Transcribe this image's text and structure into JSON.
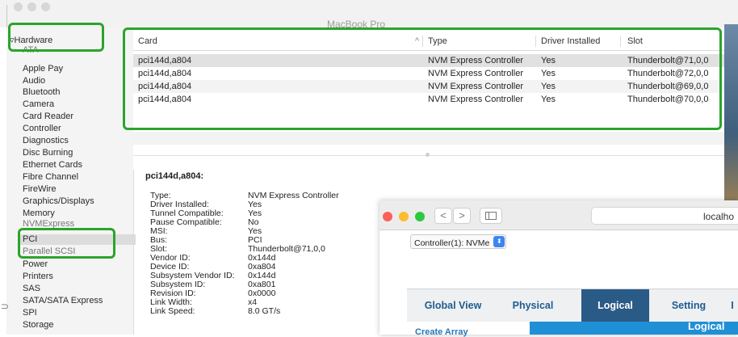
{
  "window": {
    "title": "MacBook Pro"
  },
  "sidebar": {
    "hardware_label": "Hardware",
    "items": [
      {
        "label": "ATA"
      },
      {
        "label": "Apple Pay"
      },
      {
        "label": "Audio"
      },
      {
        "label": "Bluetooth"
      },
      {
        "label": "Camera"
      },
      {
        "label": "Card Reader"
      },
      {
        "label": "Controller"
      },
      {
        "label": "Diagnostics"
      },
      {
        "label": "Disc Burning"
      },
      {
        "label": "Ethernet Cards"
      },
      {
        "label": "Fibre Channel"
      },
      {
        "label": "FireWire"
      },
      {
        "label": "Graphics/Displays"
      },
      {
        "label": "Memory"
      },
      {
        "label": "NVMExpress"
      },
      {
        "label": "PCI"
      },
      {
        "label": "Parallel SCSI"
      },
      {
        "label": "Power"
      },
      {
        "label": "Printers"
      },
      {
        "label": "SAS"
      },
      {
        "label": "SATA/SATA Express"
      },
      {
        "label": "SPI"
      },
      {
        "label": "Storage"
      }
    ],
    "selected": "PCI"
  },
  "table": {
    "columns": [
      "Card",
      "Type",
      "Driver Installed",
      "Slot"
    ],
    "sort_indicator": "^",
    "rows": [
      {
        "card": "pci144d,a804",
        "type": "NVM Express Controller",
        "driver": "Yes",
        "slot": "Thunderbolt@71,0,0"
      },
      {
        "card": "pci144d,a804",
        "type": "NVM Express Controller",
        "driver": "Yes",
        "slot": "Thunderbolt@72,0,0"
      },
      {
        "card": "pci144d,a804",
        "type": "NVM Express Controller",
        "driver": "Yes",
        "slot": "Thunderbolt@69,0,0"
      },
      {
        "card": "pci144d,a804",
        "type": "NVM Express Controller",
        "driver": "Yes",
        "slot": "Thunderbolt@70,0,0"
      }
    ]
  },
  "details": {
    "title": "pci144d,a804:",
    "fields": [
      {
        "key": "Type:",
        "value": "NVM Express Controller"
      },
      {
        "key": "Driver Installed:",
        "value": "Yes"
      },
      {
        "key": "Tunnel Compatible:",
        "value": "Yes"
      },
      {
        "key": "Pause Compatible:",
        "value": "No"
      },
      {
        "key": "MSI:",
        "value": "Yes"
      },
      {
        "key": "Bus:",
        "value": "PCI"
      },
      {
        "key": "Slot:",
        "value": "Thunderbolt@71,0,0"
      },
      {
        "key": "Vendor ID:",
        "value": "0x144d"
      },
      {
        "key": "Device ID:",
        "value": "0xa804"
      },
      {
        "key": "Subsystem Vendor ID:",
        "value": "0x144d"
      },
      {
        "key": "Subsystem ID:",
        "value": "0xa801"
      },
      {
        "key": "Revision ID:",
        "value": "0x0000"
      },
      {
        "key": "Link Width:",
        "value": "x4"
      },
      {
        "key": "Link Speed:",
        "value": "8.0 GT/s"
      }
    ]
  },
  "browser": {
    "address": "localho",
    "nav_back": "<",
    "nav_forward": ">",
    "controller_select": "Controller(1): NVMe",
    "tabs": [
      {
        "label": "Global View",
        "active": false
      },
      {
        "label": "Physical",
        "active": false
      },
      {
        "label": "Logical",
        "active": true
      },
      {
        "label": "Setting",
        "active": false
      },
      {
        "label": "I",
        "active": false
      }
    ],
    "create_array": "Create Array",
    "banner": "Logical"
  },
  "colors": {
    "highlight": "#2ba42b",
    "tab_active": "#2a5a86",
    "banner": "#1f8fd6",
    "traffic_red": "#fc5f57",
    "traffic_yellow": "#fdbc2e",
    "traffic_green": "#2ac940"
  }
}
